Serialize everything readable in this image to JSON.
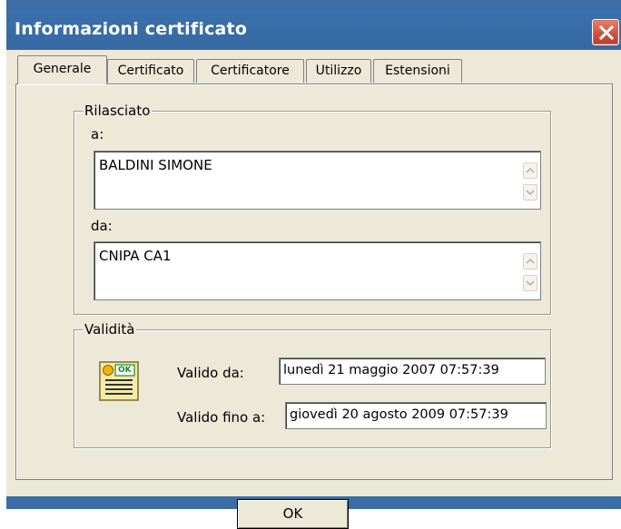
{
  "window": {
    "title": "Informazioni certificato",
    "close_icon": "close-icon",
    "accent_color": "#3a6ea5",
    "close_color": "#c9503d"
  },
  "tabs": [
    {
      "label": "Generale",
      "active": true
    },
    {
      "label": "Certificato",
      "active": false
    },
    {
      "label": "Certificatore",
      "active": false
    },
    {
      "label": "Utilizzo",
      "active": false
    },
    {
      "label": "Estensioni",
      "active": false
    }
  ],
  "issued": {
    "group_label": "Rilasciato",
    "to_label": "a:",
    "to_value": "BALDINI SIMONE",
    "by_label": "da:",
    "by_value": "CNIPA CA1"
  },
  "validity": {
    "group_label": "Validità",
    "icon": "certificate-icon",
    "icon_badge": "OK",
    "from_label": "Valido da:",
    "from_value": "lunedì 21 maggio 2007  07:57:39",
    "to_label": "Valido fino a:",
    "to_value": "giovedì 20 agosto 2009  07:57:39"
  },
  "footer": {
    "ok_label": "OK"
  }
}
